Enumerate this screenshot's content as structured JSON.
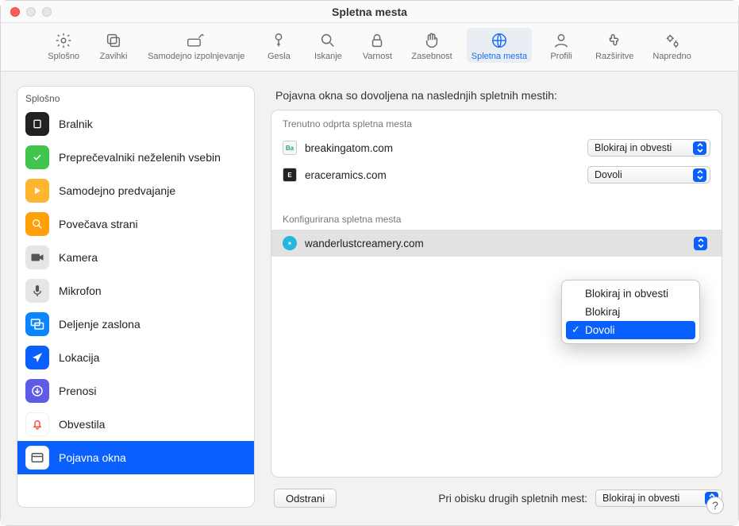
{
  "window": {
    "title": "Spletna mesta"
  },
  "toolbar": {
    "items": [
      {
        "key": "general",
        "label": "Splošno"
      },
      {
        "key": "tabs",
        "label": "Zavihki"
      },
      {
        "key": "autofill",
        "label": "Samodejno izpolnjevanje"
      },
      {
        "key": "passwords",
        "label": "Gesla"
      },
      {
        "key": "search",
        "label": "Iskanje"
      },
      {
        "key": "security",
        "label": "Varnost"
      },
      {
        "key": "privacy",
        "label": "Zasebnost"
      },
      {
        "key": "websites",
        "label": "Spletna mesta"
      },
      {
        "key": "profiles",
        "label": "Profili"
      },
      {
        "key": "extensions",
        "label": "Razširitve"
      },
      {
        "key": "advanced",
        "label": "Napredno"
      }
    ],
    "active": "websites"
  },
  "sidebar": {
    "section": "Splošno",
    "items": [
      {
        "key": "reader",
        "label": "Bralnik"
      },
      {
        "key": "blockers",
        "label": "Preprečevalniki neželenih vsebin"
      },
      {
        "key": "autoplay",
        "label": "Samodejno predvajanje"
      },
      {
        "key": "zoom",
        "label": "Povečava strani"
      },
      {
        "key": "camera",
        "label": "Kamera"
      },
      {
        "key": "microphone",
        "label": "Mikrofon"
      },
      {
        "key": "screenshare",
        "label": "Deljenje zaslona"
      },
      {
        "key": "location",
        "label": "Lokacija"
      },
      {
        "key": "downloads",
        "label": "Prenosi"
      },
      {
        "key": "notifications",
        "label": "Obvestila"
      },
      {
        "key": "popups",
        "label": "Pojavna okna"
      }
    ],
    "selected": "popups"
  },
  "content": {
    "heading": "Pojavna okna so dovoljena na naslednjih spletnih mestih:",
    "group_open": "Trenutno odprta spletna mesta",
    "group_conf": "Konfigurirana spletna mesta",
    "sites_open": [
      {
        "domain": "breakingatom.com",
        "setting": "Blokiraj in obvesti"
      },
      {
        "domain": "eraceramics.com",
        "setting": "Dovoli"
      }
    ],
    "sites_conf": [
      {
        "domain": "wanderlustcreamery.com",
        "setting": "Dovoli"
      }
    ],
    "remove_btn": "Odstrani",
    "others_label": "Pri obisku drugih spletnih mest:",
    "others_value": "Blokiraj in obvesti"
  },
  "dropdown": {
    "options": [
      "Blokiraj in obvesti",
      "Blokiraj",
      "Dovoli"
    ],
    "selected": "Dovoli"
  },
  "help": "?"
}
